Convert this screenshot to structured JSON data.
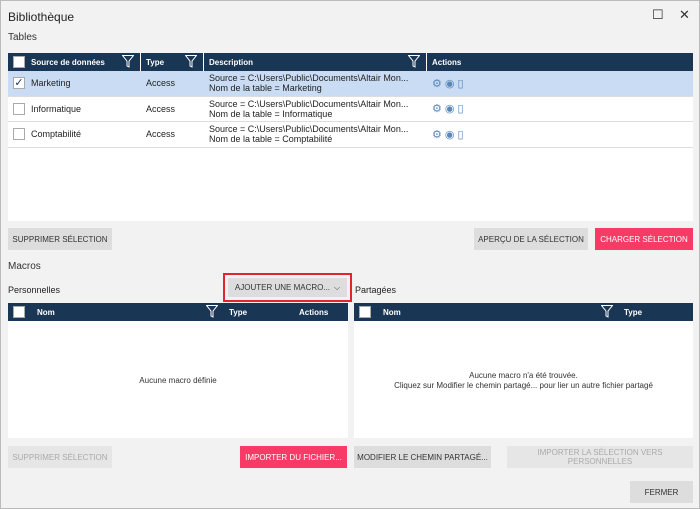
{
  "window": {
    "title": "Bibliothèque",
    "maximize_icon": "☐",
    "close_icon": "✕"
  },
  "tables": {
    "section_label": "Tables",
    "columns": [
      "Source de données",
      "Type",
      "Description",
      "Actions"
    ],
    "rows": [
      {
        "checked": true,
        "name": "Marketing",
        "type": "Access",
        "desc1": "Source = C:\\Users\\Public\\Documents\\Altair Mon...",
        "desc2": "Nom de la table = Marketing"
      },
      {
        "checked": false,
        "name": "Informatique",
        "type": "Access",
        "desc1": "Source = C:\\Users\\Public\\Documents\\Altair Mon...",
        "desc2": "Nom de la table = Informatique"
      },
      {
        "checked": false,
        "name": "Comptabilité",
        "type": "Access",
        "desc1": "Source = C:\\Users\\Public\\Documents\\Altair Mon...",
        "desc2": "Nom de la table = Comptabilité"
      }
    ],
    "delete_selection": "SUPPRIMER SÉLECTION",
    "preview_selection": "APERÇU DE LA SÉLECTION",
    "load_selection": "CHARGER SÉLECTION"
  },
  "macros": {
    "section_label": "Macros",
    "personal_label": "Personnelles",
    "shared_label": "Partagées",
    "add_macro": "AJOUTER UNE MACRO...",
    "personal_columns": [
      "Nom",
      "Type",
      "Actions"
    ],
    "shared_columns": [
      "Nom",
      "Type"
    ],
    "personal_empty": "Aucune macro définie",
    "shared_empty_1": "Aucune macro n'a été trouvée.",
    "shared_empty_2": "Cliquez sur Modifier le chemin partagé... pour lier un autre fichier partagé",
    "delete_selection": "SUPPRIMER SÉLECTION",
    "import_file": "IMPORTER DU FICHIER...",
    "edit_shared_path": "MODIFIER LE CHEMIN PARTAGÉ...",
    "import_to_personal": "IMPORTER LA SÉLECTION VERS PERSONNELLES"
  },
  "close_button": "FERMER",
  "colors": {
    "header": "#193654",
    "accent": "#f73b66",
    "selected_row": "#c9dcf3",
    "highlight": "#e0252b"
  }
}
